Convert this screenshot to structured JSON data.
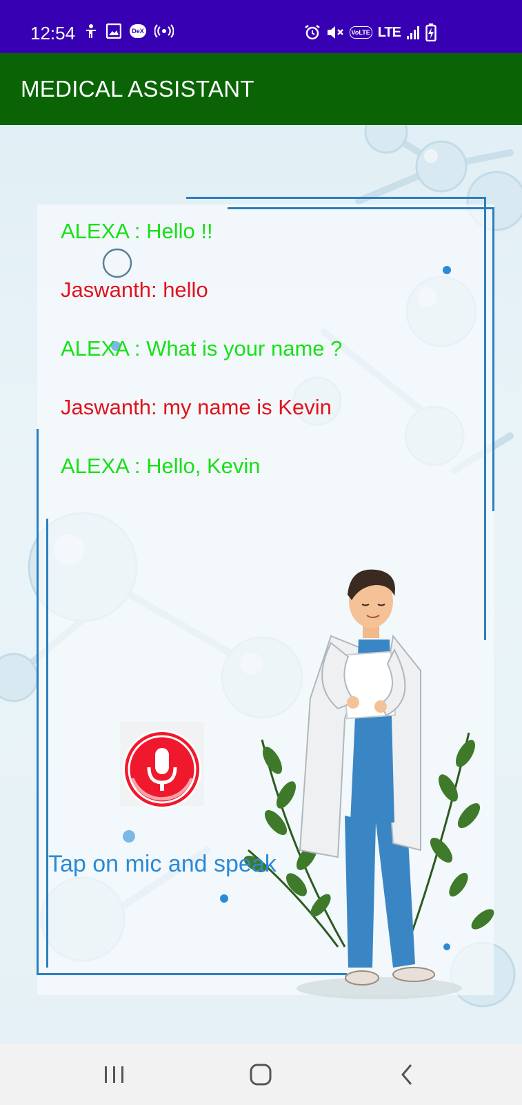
{
  "status_bar": {
    "time": "12:54",
    "left_icons": [
      "accessibility-icon",
      "gallery-icon",
      "dex-icon",
      "hotspot-icon"
    ],
    "dex_label": "DeX",
    "right_icons": [
      "alarm-icon",
      "mute-icon",
      "volte-icon",
      "signal-icon",
      "battery-charging-icon"
    ],
    "volte_label": "VoLTE",
    "network_label": "LTE"
  },
  "app_bar": {
    "title": "MEDICAL ASSISTANT"
  },
  "chat": {
    "messages": [
      {
        "speaker": "bot",
        "text": "ALEXA : Hello !!"
      },
      {
        "speaker": "user",
        "text": "Jaswanth: hello"
      },
      {
        "speaker": "bot",
        "text": "ALEXA : What is your name ?"
      },
      {
        "speaker": "user",
        "text": "Jaswanth: my name is Kevin"
      },
      {
        "speaker": "bot",
        "text": "ALEXA : Hello, Kevin"
      }
    ]
  },
  "mic": {
    "icon": "microphone-icon",
    "hint": "Tap on mic and speak"
  },
  "nav_bar": {
    "icons": [
      "recent-apps-icon",
      "home-icon",
      "back-icon"
    ]
  },
  "colors": {
    "status_bar": "#3700b3",
    "app_bar": "#0a6406",
    "bot_text": "#17e017",
    "user_text": "#e0131d",
    "hint_text": "#2b8ad6",
    "mic_red": "#f0182c",
    "frame": "#2a7fbf"
  }
}
